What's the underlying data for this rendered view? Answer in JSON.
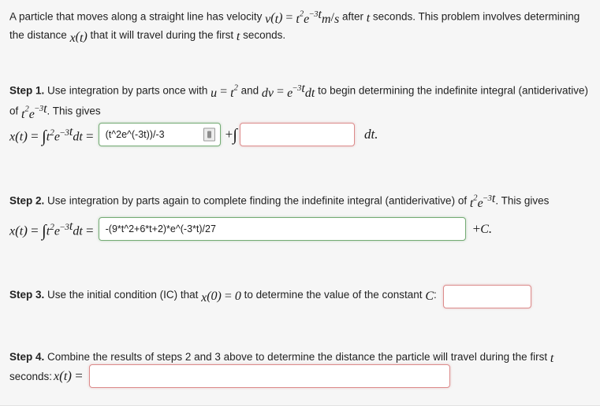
{
  "problem": {
    "intro_part1": "A particle that moves along a straight line has velocity ",
    "intro_math_v": "v(t) = t²e^(−3t) m/s",
    "intro_part2": " after ",
    "intro_var_t": "t",
    "intro_part3": " seconds. This problem involves determining the distance ",
    "intro_math_x": "x(t)",
    "intro_part4": " that it will travel during the first ",
    "intro_var_t2": "t",
    "intro_part5": " seconds."
  },
  "step1": {
    "label": "Step 1.",
    "text_a": " Use integration by parts once with ",
    "math_u": "u = t²",
    "text_b": " and ",
    "math_dv": "dv = e^(−3t) dt",
    "text_c": " to begin determining the indefinite integral (antiderivative) of ",
    "math_integrand": "t²e^(−3t)",
    "text_d": ". This gives",
    "equation_lhs": "x(t) = ∫ t²e^(−3t) dt =",
    "answer_value": "(t^2e^(-3t))/-3",
    "answer_placeholder": "",
    "answer_status": "correct",
    "plus_integral": "+∫",
    "second_answer_value": "",
    "second_answer_placeholder": "",
    "second_answer_status": "blank",
    "trailing": "dt.",
    "palette_icon": "math-palette-icon"
  },
  "step2": {
    "label": "Step 2.",
    "text_a": " Use integration by parts again to complete finding the indefinite integral (antiderivative) of ",
    "math_integrand": "t²e^(−3t)",
    "text_b": ". This gives",
    "equation_lhs": "x(t) = ∫ t²e^(−3t) dt =",
    "answer_value": "-(9*t^2+6*t+2)*e^(-3*t)/27",
    "answer_placeholder": "",
    "answer_status": "correct",
    "trailing": "+C."
  },
  "step3": {
    "label": "Step 3.",
    "text_a": " Use the initial condition (IC) that ",
    "math_ic": "x(0) = 0",
    "text_b": " to determine the value of the constant ",
    "math_c": "C",
    "text_c": ":",
    "answer_value": "",
    "answer_placeholder": "",
    "answer_status": "blank"
  },
  "step4": {
    "label": "Step 4.",
    "text_a": " Combine the results of steps 2 and 3 above to determine the distance the particle will travel during the first ",
    "math_t": "t",
    "text_b": " seconds: ",
    "math_xt": "x(t) =",
    "answer_value": "",
    "answer_placeholder": "",
    "answer_status": "blank"
  },
  "colors": {
    "background": "#f6f6f6",
    "correct_border": "#74ab74",
    "blank_border": "#dc8b8b",
    "text": "#222222"
  }
}
